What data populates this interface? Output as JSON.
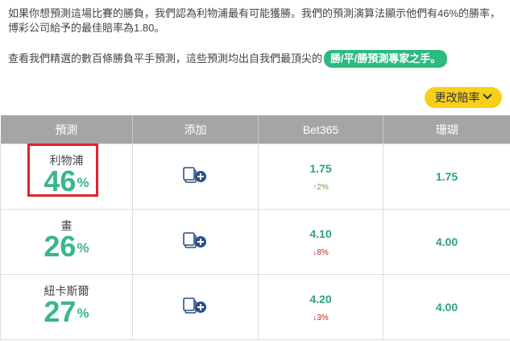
{
  "intro": {
    "line1": "如果你想預測這場比賽的勝負，我們認為利物浦最有可能獲勝。我們的預測演算法顯示他們有46%的勝率，博彩公司給予的最佳賠率為1.80。",
    "line2_prefix": "查看我們精選的數百條勝負平手預測，這些預測均出自我們最頂尖的",
    "pill": "勝/平/勝預測專家之手。"
  },
  "odds_button": {
    "label": "更改賠率"
  },
  "table": {
    "headers": [
      "預測",
      "添加",
      "Bet365",
      "珊瑚"
    ],
    "rows": [
      {
        "outcome": "利物浦",
        "percent": "46",
        "pct_sign": "%",
        "bet365": "1.75",
        "change": "2%",
        "direction": "up",
        "coral": "1.75"
      },
      {
        "outcome": "畫",
        "percent": "26",
        "pct_sign": "%",
        "bet365": "4.10",
        "change": "8%",
        "direction": "down",
        "coral": "4.00"
      },
      {
        "outcome": "紐卡斯爾",
        "percent": "27",
        "pct_sign": "%",
        "bet365": "4.20",
        "change": "3%",
        "direction": "down",
        "coral": "4.00"
      }
    ]
  },
  "colors": {
    "accent_green": "#3bb68a",
    "pill_green": "#2eb97f",
    "button_yellow": "#f6d01a",
    "header_gray": "#a5a5a5",
    "highlight_red": "#e0232f"
  },
  "icons": {
    "add": "add-to-betslip-icon",
    "up": "arrow-up-icon",
    "down": "arrow-down-icon",
    "chevron": "chevron-down-icon"
  }
}
